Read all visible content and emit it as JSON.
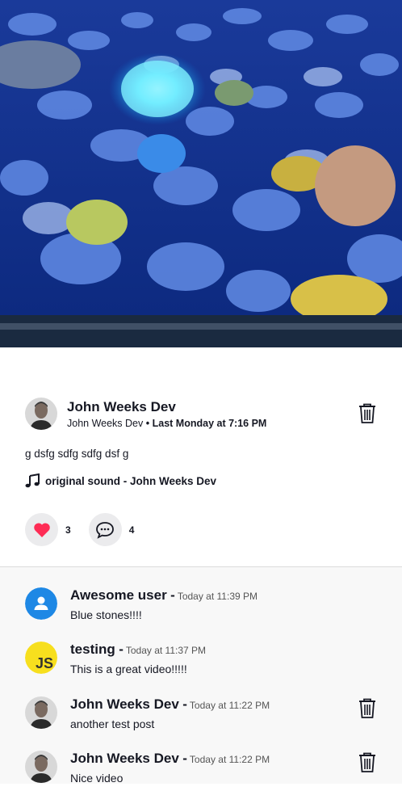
{
  "post": {
    "author_name": "John Weeks Dev",
    "author_handle": "John Weeks Dev",
    "separator": "•",
    "posted_time": "Last Monday at 7:16 PM",
    "caption": "g dsfg sdfg sdfg dsf g",
    "sound": "original sound - John Weeks Dev",
    "likes": "3",
    "comments": "4"
  },
  "comments": [
    {
      "name": "Awesome user",
      "dash": "-",
      "time": "Today at 11:39 PM",
      "text": "Blue stones!!!!",
      "avatar": "default-user-icon",
      "deletable": false
    },
    {
      "name": "testing",
      "dash": "-",
      "time": "Today at 11:37 PM",
      "text": "This is a great video!!!!!",
      "avatar": "js-logo",
      "deletable": false
    },
    {
      "name": "John Weeks Dev",
      "dash": "-",
      "time": "Today at 11:22 PM",
      "text": "another test post",
      "avatar": "photo",
      "deletable": true
    },
    {
      "name": "John Weeks Dev",
      "dash": "-",
      "time": "Today at 11:22 PM",
      "text": "Nice video",
      "avatar": "photo",
      "deletable": true
    }
  ],
  "colors": {
    "like_heart": "#fe2c55",
    "user_avatar_blue": "#1e88e5",
    "js_yellow": "#f7df1e"
  }
}
